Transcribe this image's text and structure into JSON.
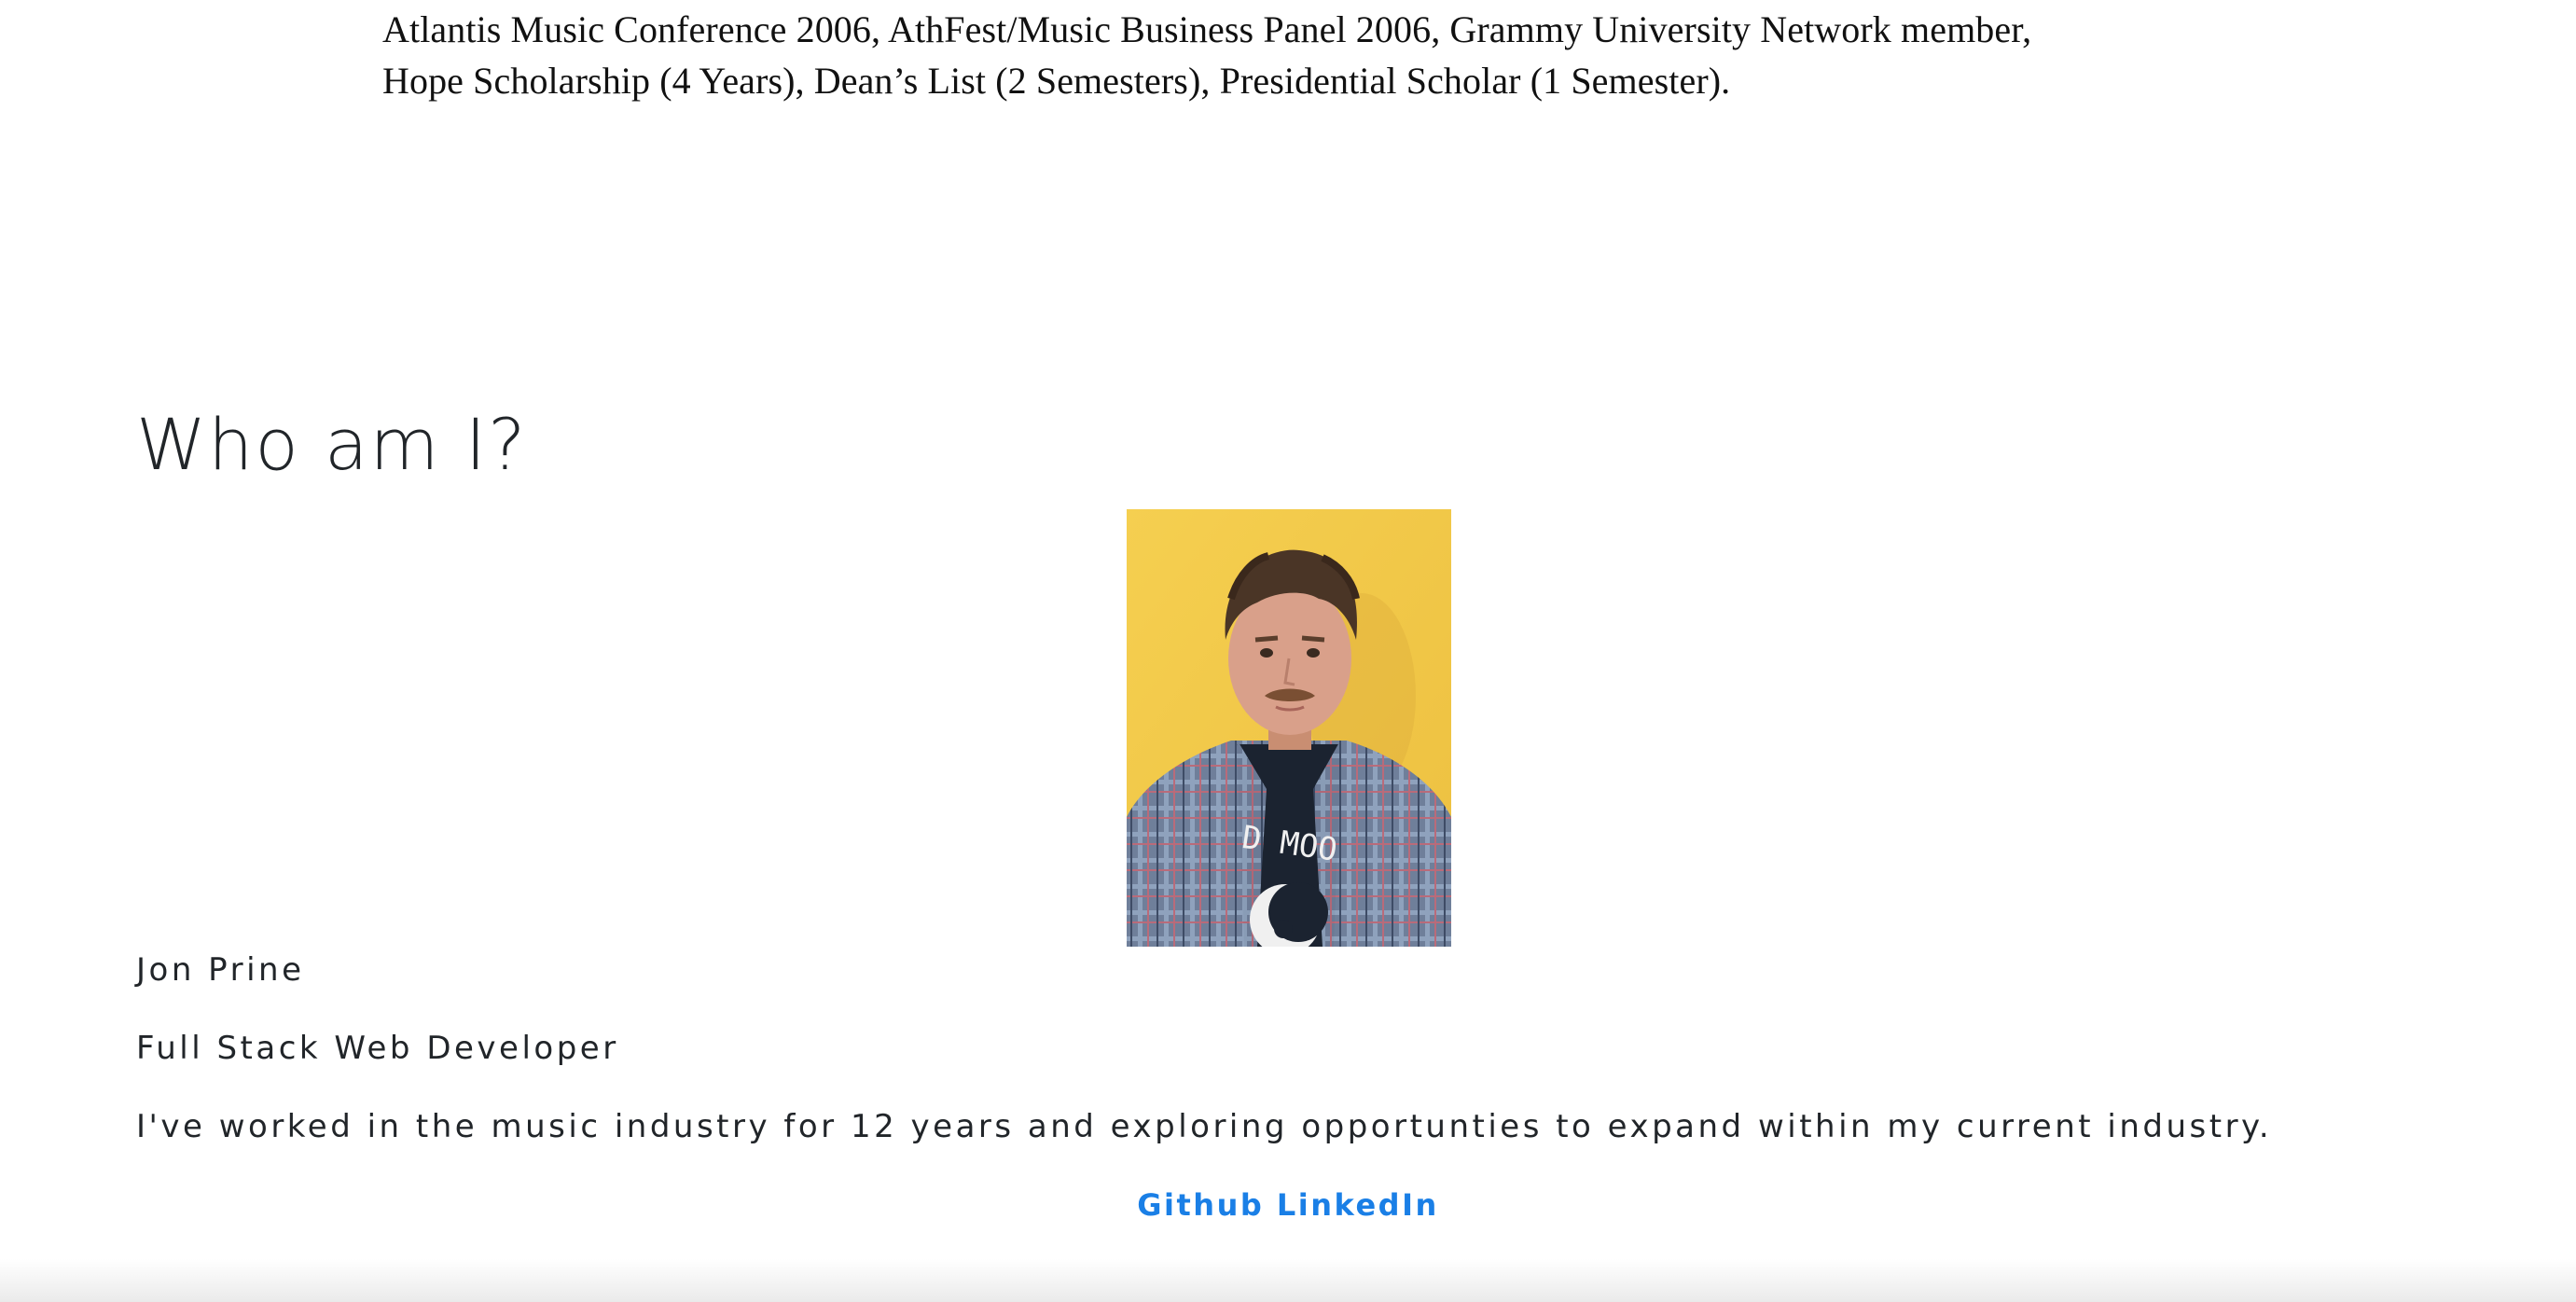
{
  "resume": {
    "line1": "Atlantis Music Conference 2006, AthFest/Music Business Panel 2006, Grammy University Network member,",
    "line2": "Hope Scholarship (4 Years), Dean’s List (2 Semesters), Presidential Scholar (1 Semester)."
  },
  "about": {
    "heading": "Who am I?",
    "name": "Jon Prine",
    "title": "Full Stack Web Developer",
    "bio": "I've worked in the music industry for 12 years and exploring opportunties to expand within my current industry.",
    "photo_shirt_text": "D MOO"
  },
  "links": {
    "github": "Github",
    "linkedin": "LinkedIn"
  },
  "colors": {
    "link": "#1a7fe6",
    "text": "#212529",
    "photo_background": "#f2c94a"
  }
}
